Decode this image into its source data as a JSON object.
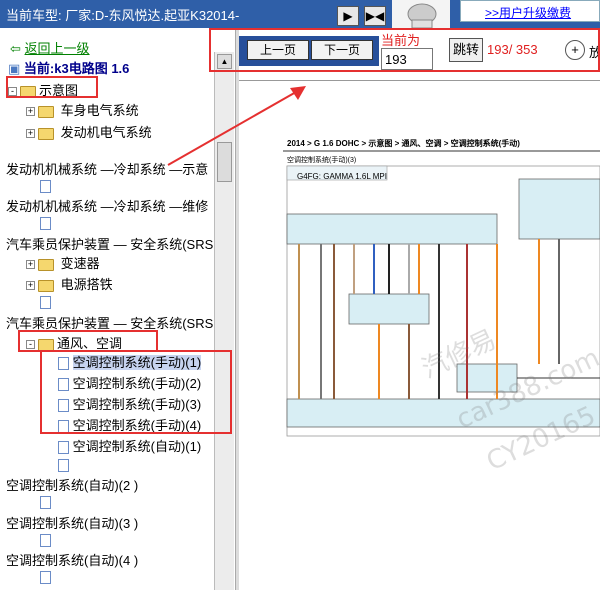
{
  "topbar": {
    "car_type": "当前车型:  厂家:D-东风悦达.起亚K32014-",
    "btn_next": "▶",
    "btn_skip": "▶◀",
    "upgrade_link": ">>用户升级缴费"
  },
  "tree": {
    "back_link": "返回上一级",
    "current": "当前:k3电路图 1.6",
    "items": [
      {
        "text": "示意图"
      },
      {
        "text": "车身电气系统"
      },
      {
        "text": "发动机电气系统"
      },
      {
        "text": "发动机机械系统 —冷却系统 —示意"
      },
      {
        "text": "发动机机械系统 —冷却系统 —维修"
      },
      {
        "text": "汽车乘员保护装置 — 安全系统(SRS"
      },
      {
        "text": "变速器"
      },
      {
        "text": "电源搭铁"
      },
      {
        "text": "汽车乘员保护装置 — 安全系统(SRS"
      },
      {
        "text": "通风、空调"
      },
      {
        "text": "空调控制系统(手动)(1)"
      },
      {
        "text": "空调控制系统(手动)(2)"
      },
      {
        "text": "空调控制系统(手动)(3)"
      },
      {
        "text": "空调控制系统(手动)(4)"
      },
      {
        "text": "空调控制系统(自动)(1)"
      },
      {
        "text": "空调控制系统(自动)(2 )"
      },
      {
        "text": "空调控制系统(自动)(3 )"
      },
      {
        "text": "空调控制系统(自动)(4 )"
      }
    ]
  },
  "toolbar": {
    "prev": "上一页",
    "next": "下一页",
    "current_label": "当前为",
    "page_value": "193",
    "jump": "跳转",
    "page_count": "193/ 353",
    "zoom_label": "放"
  },
  "diagram": {
    "title": "2014 > G 1.6 DOHC > 示意图 > 通风、空调 > 空调控制系统(手动)",
    "subtitle": "空调控制系统(手动)(3)",
    "engine": "G4FG: GAMMA 1.6L MPI",
    "watermark1": "car388.com",
    "watermark2": "CY20165",
    "watermark3": "汽修易"
  }
}
